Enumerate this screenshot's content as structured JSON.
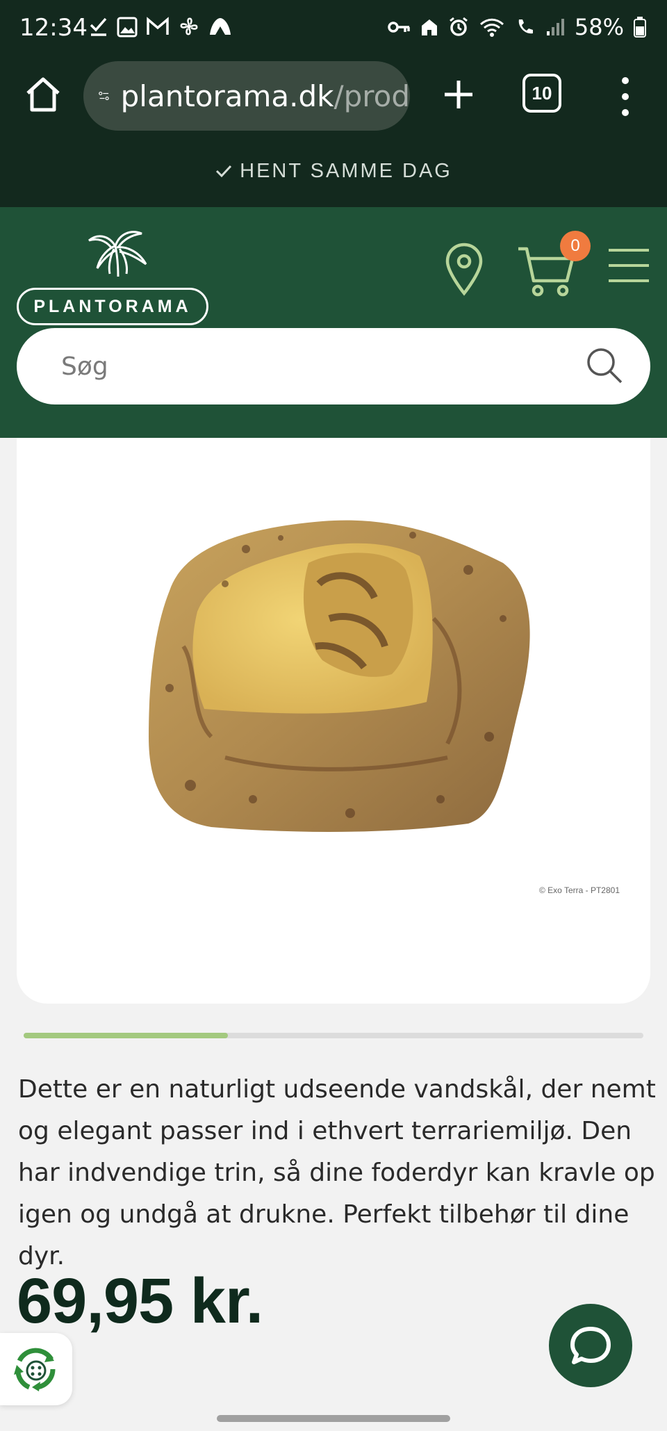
{
  "status_bar": {
    "time": "12:34",
    "battery": "58%"
  },
  "browser": {
    "url_domain": "plantorama.dk",
    "url_path": "/prod",
    "tab_count": "10"
  },
  "announcement": {
    "text": "HENT SAMME DAG"
  },
  "header": {
    "logo_text": "PLANTORAMA",
    "cart_count": "0",
    "search_placeholder": "Søg"
  },
  "product": {
    "image_credit": "© Exo Terra - PT2801",
    "carousel_progress": 0.33,
    "description": "Dette er en naturligt udseende vandskål, der nemt og elegant passer ind i ethvert terrariemiljø. Den har indvendige trin, så dine foderdyr kan kravle op igen og undgå at drukne. Perfekt tilbehør til dine dyr.",
    "price": "69,95 kr."
  },
  "colors": {
    "dark_green": "#13291e",
    "brand_green": "#1f5237",
    "badge_orange": "#f07b3f",
    "progress_green": "#a3c97f"
  }
}
